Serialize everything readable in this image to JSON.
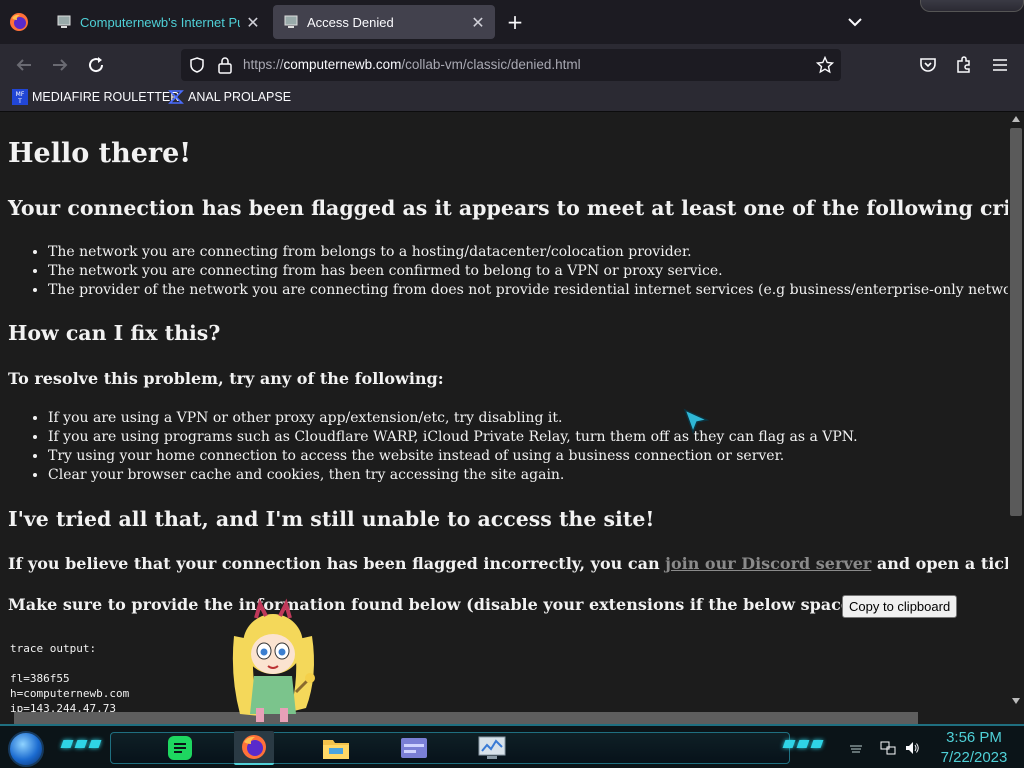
{
  "browser": {
    "tabs": [
      {
        "title": "Computernewb's Internet Pub",
        "active": false
      },
      {
        "title": "Access Denied",
        "active": true
      }
    ],
    "url_prefix": "https://",
    "url_host": "computernewb.com",
    "url_path": "/collab-vm/classic/denied.html",
    "bookmarks": [
      {
        "label": "MEDIAFIRE ROULETTER"
      },
      {
        "label": "ANAL PROLAPSE"
      }
    ]
  },
  "page": {
    "h1": "Hello there!",
    "flagged_heading": "Your connection has been flagged as it appears to meet at least one of the following criteria:",
    "criteria": [
      "The network you are connecting from belongs to a hosting/datacenter/colocation provider.",
      "The network you are connecting from has been confirmed to belong to a VPN or proxy service.",
      "The provider of the network you are connecting from does not provide residential internet services (e.g business/enterprise-only networks)."
    ],
    "fix_heading": "How can I fix this?",
    "resolve_heading": "To resolve this problem, try any of the following:",
    "fixes": [
      "If you are using a VPN or other proxy app/extension/etc, try disabling it.",
      "If you are using programs such as Cloudflare WARP, iCloud Private Relay, turn them off as they can flag as a VPN.",
      "Try using your home connection to access the website instead of using a business connection or server.",
      "Clear your browser cache and cookies, then try accessing the site again."
    ],
    "still_heading": "I've tried all that, and I'm still unable to access the site!",
    "incorrect_pre": "If you believe that your connection has been flagged incorrectly, you can ",
    "discord_link": "join our Discord server",
    "incorrect_post": " and open a ticket.",
    "provide_info": "Make sure to provide the information found below (disable your extensions if the below space is empty):",
    "copy_button": "Copy to clipboard",
    "trace_label": "trace output:",
    "trace_lines": [
      "fl=386f55",
      "h=computernewb.com",
      "ip=143.244.47.73"
    ]
  },
  "taskbar": {
    "time": "3:56 PM",
    "date": "7/22/2023",
    "accent": "#4fd0d7"
  }
}
